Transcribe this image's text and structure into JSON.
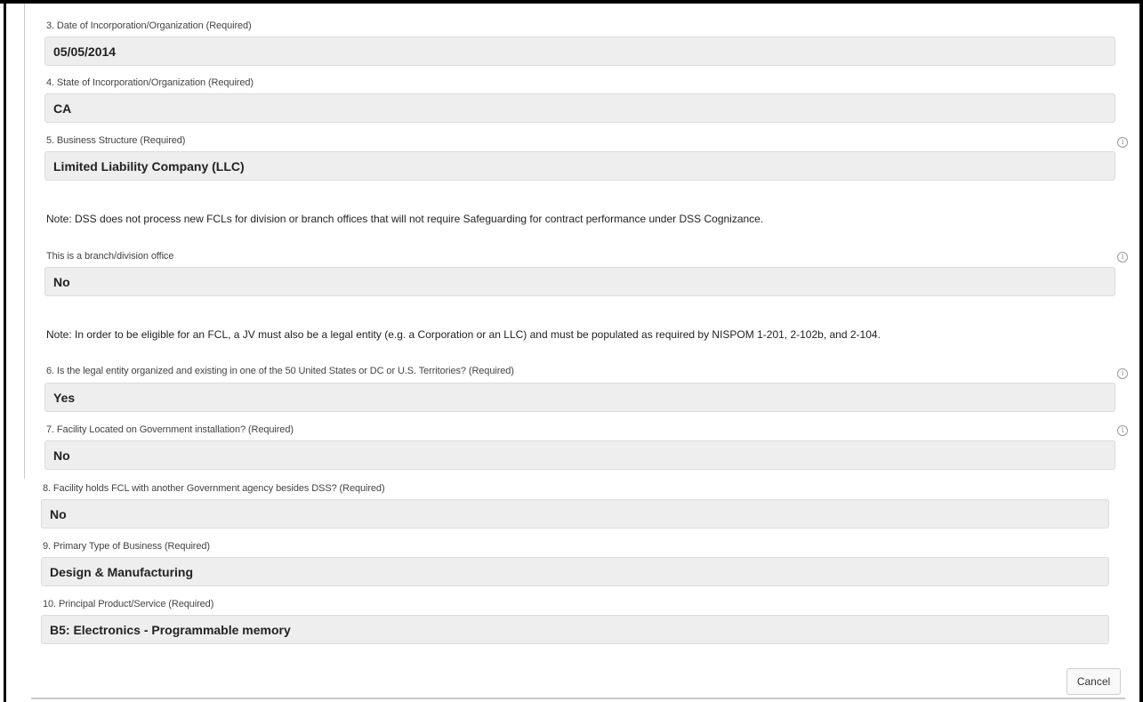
{
  "fields": [
    {
      "label": "3. Date of Incorporation/Organization (Required)",
      "value": "05/05/2014"
    },
    {
      "label": "4. State of Incorporation/Organization (Required)",
      "value": "CA"
    },
    {
      "label": "5. Business Structure (Required)",
      "value": "Limited Liability Company (LLC)"
    },
    {
      "label": "This is a branch/division office",
      "value": "No"
    },
    {
      "label": "6. Is the legal entity organized and existing in one of the 50 United States or DC or U.S. Territories? (Required)",
      "value": "Yes"
    },
    {
      "label": "7. Facility Located on Government installation? (Required)",
      "value": "No"
    },
    {
      "label": "8. Facility holds FCL with another Government agency besides DSS? (Required)",
      "value": "No"
    },
    {
      "label": "9. Primary Type of Business (Required)",
      "value": "Design & Manufacturing"
    },
    {
      "label": "10. Principal Product/Service (Required)",
      "value": "B5: Electronics - Programmable memory"
    }
  ],
  "notes": [
    "Note: DSS does not process new FCLs for division or branch offices that will not require Safeguarding for contract performance under DSS Cognizance.",
    "Note: In order to be eligible for an FCL, a JV must also be a legal entity (e.g. a Corporation or an LLC) and must be populated as required by NISPOM 1-201, 2-102b, and 2-104."
  ],
  "info_icon_glyph": "i",
  "icon_names": [
    "info-icon"
  ],
  "actions": {
    "cancel_label": "Cancel"
  }
}
